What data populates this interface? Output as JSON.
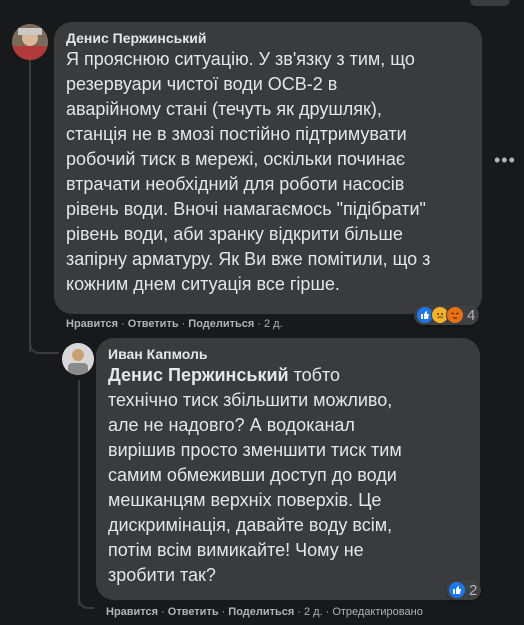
{
  "comments": [
    {
      "author": "Денис Пержинський",
      "text_lines": [
        "Я прояснюю ситуацію. У зв'язку з тим, що",
        "резервуари чистої води ОСВ-2 в",
        "аварійному стані (течуть як друшляк),",
        "станція не в змозі постійно підтримувати",
        "робочий тиск в мережі, оскільки починає",
        "втрачати необхідний для роботи насосів",
        "рівень води. Вночі намагаємось \"підібрати\"",
        "рівень води, аби зранку відкрити більше",
        "запірну арматуру. Як Ви вже помітили, що з",
        "кожним днем ситуація все гірше."
      ],
      "actions": {
        "like": "Нравится",
        "reply": "Ответить",
        "share": "Поделиться",
        "time": "2 д."
      },
      "reactions": {
        "icons": [
          "like-reaction-icon",
          "sad-reaction-icon",
          "angry-reaction-icon"
        ],
        "count": "4"
      },
      "more_icon": "more-options-icon"
    },
    {
      "author": "Иван Капмоль",
      "mention": "Денис Пержинський",
      "text_first_rest": " тобто",
      "text_lines": [
        "технічно тиск збільшити можливо,",
        "але не надовго? А водоканал",
        "вирішив просто зменшити тиск тим",
        "самим обмеживши доступ до води",
        "мешканцям верхніх поверхів. Це",
        "дискримінація, давайте воду всім,",
        "потім всім вимикайте! Чому не",
        "зробити так?"
      ],
      "actions": {
        "like": "Нравится",
        "reply": "Ответить",
        "share": "Поделиться",
        "time": "2 д.",
        "edited": "Отредактировано"
      },
      "reactions": {
        "icons": [
          "like-reaction-icon"
        ],
        "count": "2"
      }
    }
  ],
  "colors": {
    "background": "#18191a",
    "bubble": "#3a3b3c",
    "text": "#e4e6eb",
    "secondary_text": "#b0b3b8",
    "like_blue": "#1877f2"
  }
}
